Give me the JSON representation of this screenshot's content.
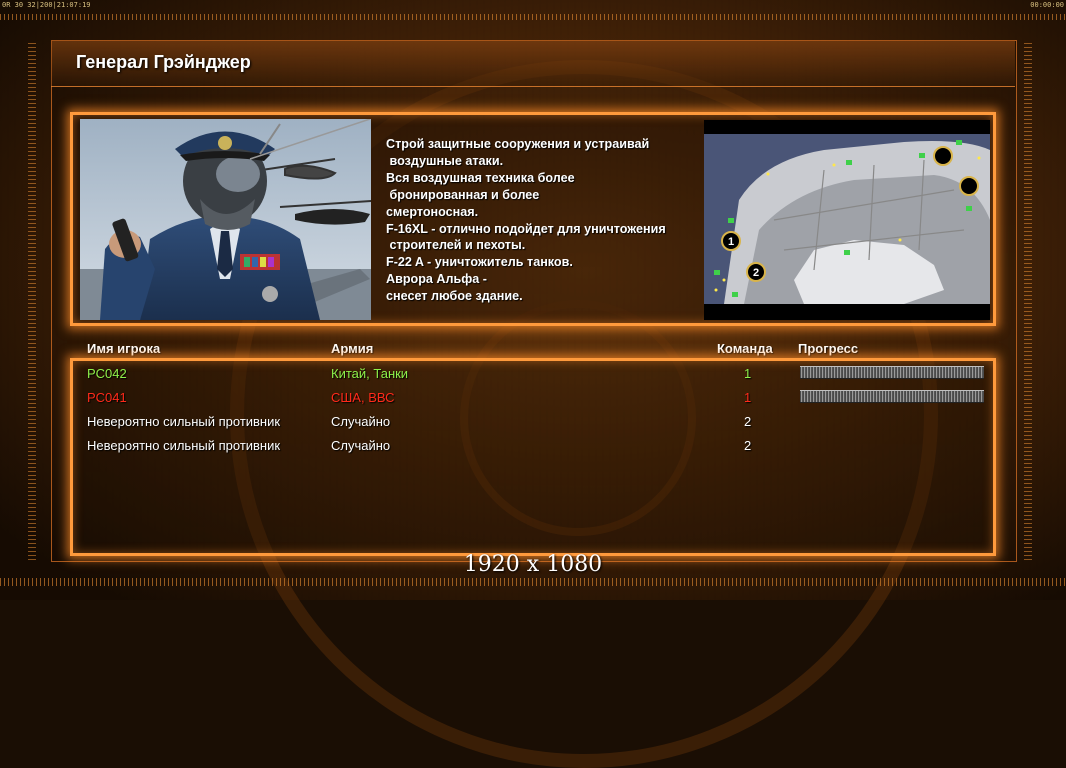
{
  "topbar": {
    "left_status": "0R 30 32|200|21:07:19",
    "right_time": "00:00:00"
  },
  "title": "Генерал Грэйнджер",
  "description_lines": [
    "Строй защитные сооружения и устраивай",
    " воздушные атаки.",
    "Вся воздушная техника более",
    " бронированная и более",
    "смертоносная.",
    "F-16XL - отлично подойдет для уничтожения",
    " строителей и пехоты.",
    "F-22 A - уничтожитель танков.",
    "Аврора Альфа -",
    "снесет любое здание."
  ],
  "minimap": {
    "start_markers": [
      "1",
      "2"
    ]
  },
  "table": {
    "headers": {
      "player": "Имя игрока",
      "army": "Армия",
      "team": "Команда",
      "progress": "Прогресс"
    },
    "rows": [
      {
        "player": "PC042",
        "army": "Китай, Танки",
        "team": "1",
        "color": "#8ef04a",
        "progress": true
      },
      {
        "player": "PC041",
        "army": "США, ВВС",
        "team": "1",
        "color": "#ff2a1a",
        "progress": true
      },
      {
        "player": "Невероятно сильный противник",
        "army": "Случайно",
        "team": "2",
        "color": "#ffffff",
        "progress": false
      },
      {
        "player": "Невероятно сильный противник",
        "army": "Случайно",
        "team": "2",
        "color": "#ffffff",
        "progress": false
      }
    ]
  },
  "resolution": "1920 x 1080",
  "colors": {
    "accent": "#ff9a3c",
    "player1": "#8ef04a",
    "player2": "#ff2a1a"
  }
}
